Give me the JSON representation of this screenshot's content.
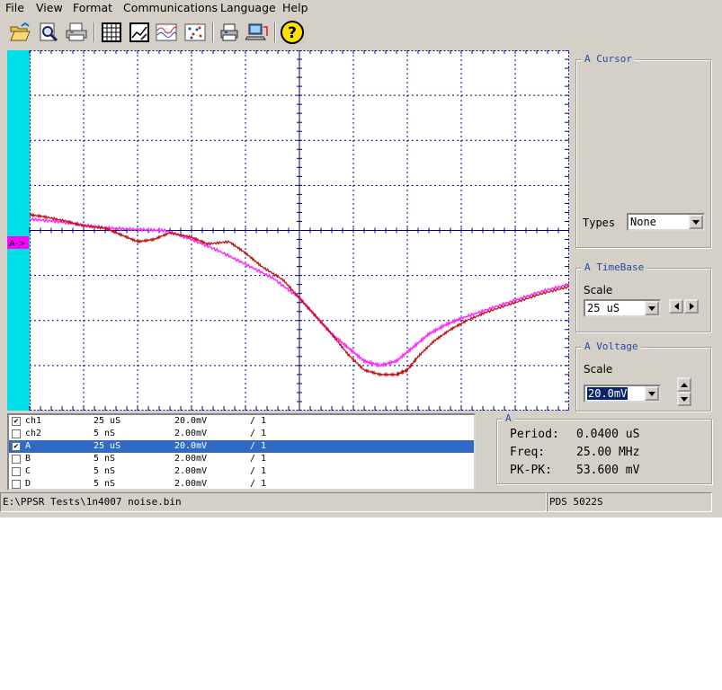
{
  "menu": [
    "File",
    "View",
    "Format",
    "Communications",
    "Language",
    "Help"
  ],
  "toolbar_icons": [
    "open-folder-icon",
    "zoom-preview-icon",
    "print-icon",
    "table-icon",
    "chart-edit-icon",
    "waveform-icon",
    "scatter-icon",
    "printer-setup-icon",
    "network-pc-icon",
    "help-icon"
  ],
  "scope": {
    "marker": "A->",
    "grid_divisions_x": 10,
    "grid_divisions_y": 8,
    "colors": {
      "background": "#ffffff",
      "grid": "#000080",
      "left_bar": "#00e0e8",
      "trace_ch1": "#c01010",
      "trace_a": "#ff30ff",
      "marker_bg": "#ff00ff"
    }
  },
  "chart_data": {
    "type": "line",
    "xlim": [
      0,
      10
    ],
    "ylim": [
      -4,
      4
    ],
    "series": [
      {
        "x": [
          0,
          0.3,
          0.7,
          1.0,
          1.4,
          1.7,
          2.0,
          2.3,
          2.6,
          3.0,
          3.3,
          3.7,
          4.0,
          4.3,
          4.7,
          5.0,
          5.3,
          5.6,
          5.9,
          6.2,
          6.5,
          6.8,
          7.0,
          7.2,
          7.5,
          7.8,
          8.1,
          8.5,
          9.0,
          9.5,
          10.0
        ],
        "y": [
          0.35,
          0.3,
          0.2,
          0.1,
          0.05,
          -0.1,
          -0.25,
          -0.2,
          -0.05,
          -0.15,
          -0.3,
          -0.25,
          -0.5,
          -0.8,
          -1.1,
          -1.5,
          -1.9,
          -2.3,
          -2.75,
          -3.1,
          -3.2,
          -3.2,
          -3.1,
          -2.8,
          -2.45,
          -2.2,
          -2.0,
          -1.8,
          -1.6,
          -1.4,
          -1.25
        ]
      },
      {
        "x": [
          0,
          0.5,
          1.0,
          1.5,
          2.0,
          2.5,
          3.0,
          3.5,
          4.0,
          4.5,
          5.0,
          5.3,
          5.6,
          5.9,
          6.2,
          6.5,
          6.8,
          7.1,
          7.4,
          7.7,
          8.0,
          8.5,
          9.0,
          9.5,
          10.0
        ],
        "y": [
          0.25,
          0.2,
          0.12,
          0.05,
          0.02,
          0.0,
          -0.2,
          -0.45,
          -0.75,
          -1.05,
          -1.5,
          -1.9,
          -2.3,
          -2.6,
          -2.9,
          -3.0,
          -2.9,
          -2.6,
          -2.3,
          -2.1,
          -1.95,
          -1.75,
          -1.55,
          -1.35,
          -1.2
        ]
      }
    ]
  },
  "cursor_panel": {
    "title": "A   Cursor",
    "types_label": "Types",
    "types_value": "None"
  },
  "timebase_panel": {
    "title": "A   TimeBase",
    "scale_label": "Scale",
    "scale_value": "25 uS"
  },
  "voltage_panel": {
    "title": "A   Voltage",
    "scale_label": "Scale",
    "scale_value": "20.0mV"
  },
  "channels": [
    {
      "checked": true,
      "name": "ch1",
      "time": "25  uS",
      "volt": "20.0mV",
      "probe": "/ 1",
      "selected": false
    },
    {
      "checked": false,
      "name": "ch2",
      "time": "5  nS",
      "volt": "2.00mV",
      "probe": "/ 1",
      "selected": false
    },
    {
      "checked": true,
      "name": "A",
      "time": "25  uS",
      "volt": "20.0mV",
      "probe": "/ 1",
      "selected": true
    },
    {
      "checked": false,
      "name": "B",
      "time": "5  nS",
      "volt": "2.00mV",
      "probe": "/ 1",
      "selected": false
    },
    {
      "checked": false,
      "name": "C",
      "time": "5  nS",
      "volt": "2.00mV",
      "probe": "/ 1",
      "selected": false
    },
    {
      "checked": false,
      "name": "D",
      "time": "5  nS",
      "volt": "2.00mV",
      "probe": "/ 1",
      "selected": false
    }
  ],
  "measurement": {
    "title": "A",
    "period": {
      "label": "Period:",
      "value": "0.0400 uS"
    },
    "freq": {
      "label": "Freq:",
      "value": "25.00 MHz"
    },
    "pkpk": {
      "label": "PK-PK:",
      "value": "53.600 mV"
    }
  },
  "status": {
    "file_path": "E:\\PPSR Tests\\1n4007 noise.bin",
    "device": "PDS 5022S"
  }
}
